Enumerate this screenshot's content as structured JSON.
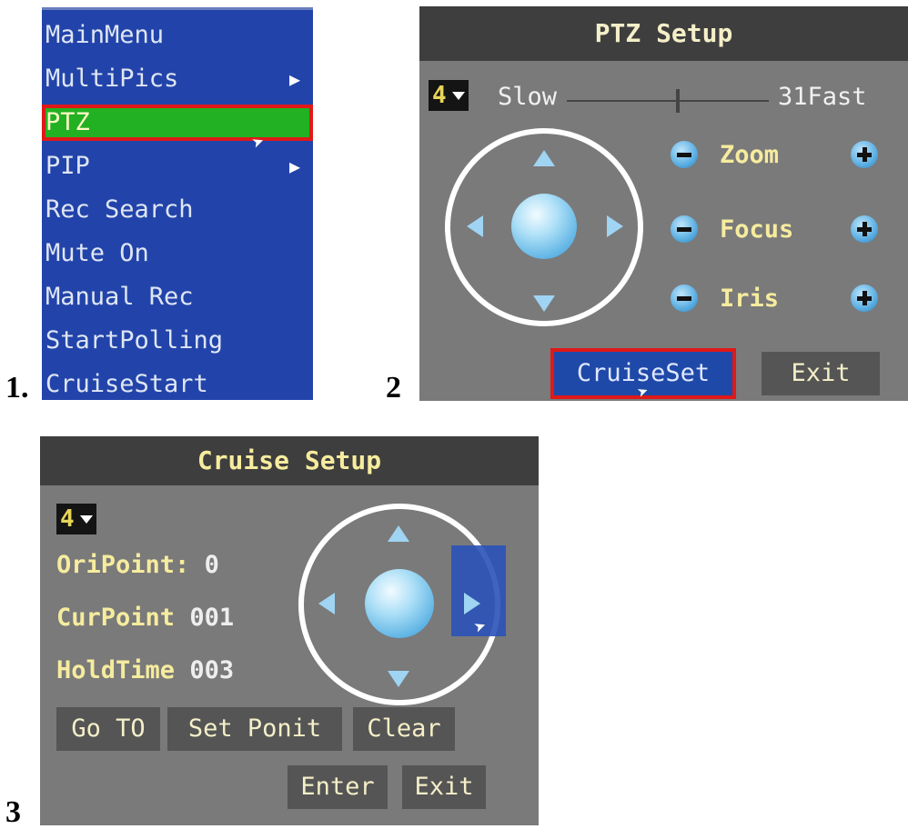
{
  "steps": [
    "1.",
    "2",
    "3"
  ],
  "main_menu": {
    "items": [
      {
        "label": "MainMenu",
        "has_submenu": false
      },
      {
        "label": "MultiPics",
        "has_submenu": true
      },
      {
        "label": "PTZ",
        "has_submenu": false,
        "selected": true
      },
      {
        "label": "PIP",
        "has_submenu": true
      },
      {
        "label": "Rec Search",
        "has_submenu": false
      },
      {
        "label": "Mute On",
        "has_submenu": false
      },
      {
        "label": "Manual Rec",
        "has_submenu": false
      },
      {
        "label": "StartPolling",
        "has_submenu": false
      },
      {
        "label": "CruiseStart",
        "has_submenu": false
      }
    ],
    "submenu_glyph": "▶"
  },
  "ptz_setup": {
    "title": "PTZ Setup",
    "channel": "4",
    "speed_slow_label": "Slow",
    "speed_value": "31",
    "speed_fast_label": "Fast",
    "speed_level": 0.55,
    "controls": [
      {
        "label": "Zoom"
      },
      {
        "label": "Focus"
      },
      {
        "label": "Iris"
      }
    ],
    "buttons": {
      "cruise_set": "CruiseSet",
      "exit": "Exit"
    }
  },
  "cruise_setup": {
    "title": "Cruise Setup",
    "channel": "4",
    "ori_point_label": "OriPoint:",
    "ori_point_value": "0",
    "cur_point_label": "CurPoint",
    "cur_point_value": "001",
    "hold_time_label": "HoldTime",
    "hold_time_value": "003",
    "buttons": {
      "go_to": "Go TO",
      "set_point": "Set Ponit",
      "clear": "Clear",
      "enter": "Enter",
      "exit": "Exit"
    }
  },
  "colors": {
    "menu_bg": "#2244aa",
    "menu_selected": "#22b122",
    "highlight_border": "#e01818",
    "panel_bg": "#7a7a7a",
    "titlebar_bg": "#3e3e3e"
  }
}
